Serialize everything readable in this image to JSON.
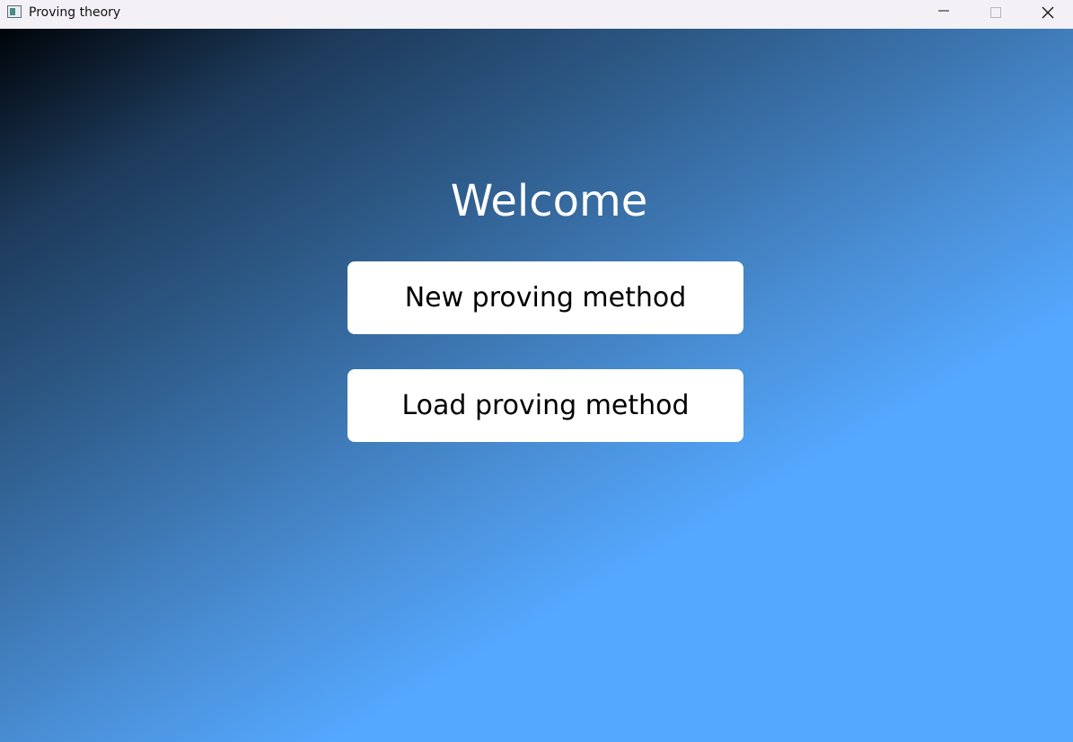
{
  "window": {
    "title": "Proving theory",
    "icons": {
      "app": "app-window-icon",
      "minimize": "minimize-icon",
      "maximize": "maximize-icon",
      "close": "close-icon"
    }
  },
  "main": {
    "heading": "Welcome",
    "buttons": {
      "new_label": "New proving method",
      "load_label": "Load proving method"
    }
  },
  "colors": {
    "titlebar": "#f3f1f6",
    "gradient_dark": "#000409",
    "gradient_light": "#54a8ff",
    "button_bg": "#ffffff",
    "heading_text": "#ffffff"
  }
}
